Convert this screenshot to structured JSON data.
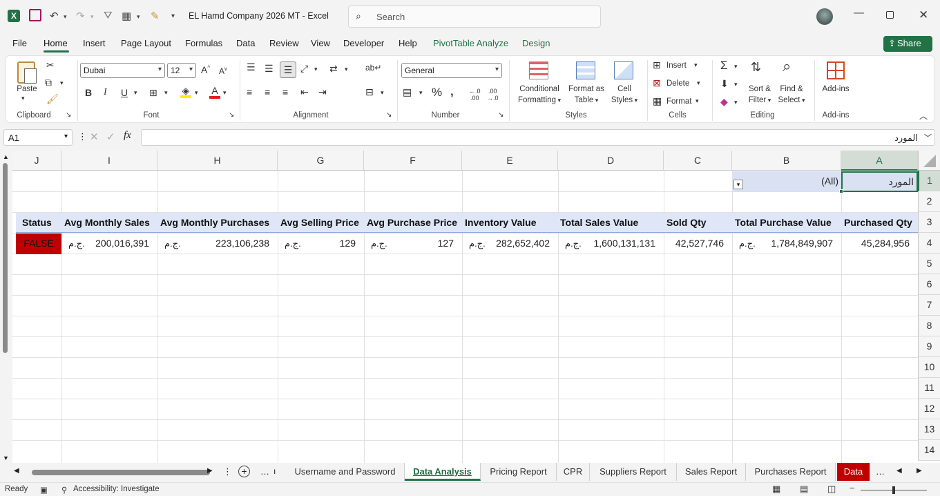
{
  "window": {
    "title": "EL Hamd Company 2026  MT  -  Excel",
    "search_placeholder": "Search"
  },
  "menu": [
    "File",
    "Home",
    "Insert",
    "Page Layout",
    "Formulas",
    "Data",
    "Review",
    "View",
    "Developer",
    "Help",
    "PivotTable Analyze",
    "Design"
  ],
  "share_label": "Share",
  "ribbon": {
    "clipboard": {
      "paste": "Paste",
      "group": "Clipboard"
    },
    "font": {
      "name": "Dubai",
      "size": "12",
      "group": "Font"
    },
    "alignment": {
      "group": "Alignment"
    },
    "number": {
      "format": "General",
      "group": "Number"
    },
    "styles": {
      "conditional": "Conditional",
      "formatting": "Formatting",
      "format_as": "Format as",
      "table": "Table",
      "cell": "Cell",
      "cell_styles": "Styles",
      "group": "Styles"
    },
    "cells": {
      "insert": "Insert",
      "delete": "Delete",
      "format": "Format",
      "group": "Cells"
    },
    "editing": {
      "sort": "Sort &",
      "filter": "Filter",
      "find": "Find &",
      "select": "Select",
      "group": "Editing"
    },
    "addins": {
      "label": "Add-ins",
      "group": "Add-ins"
    }
  },
  "formula_bar": {
    "name_box": "A1",
    "content": "المورد"
  },
  "columns": [
    "J",
    "I",
    "H",
    "G",
    "F",
    "E",
    "D",
    "C",
    "B",
    "A"
  ],
  "rows": [
    "1",
    "2",
    "3",
    "4",
    "5",
    "6",
    "7",
    "8",
    "9",
    "10",
    "11",
    "12",
    "13",
    "14"
  ],
  "cells": {
    "a1": "المورد",
    "b1": "(All)",
    "headers": {
      "j": "Status",
      "i": "Avg Monthly Sales",
      "h": "Avg Monthly Purchases",
      "g": "Avg Selling Price",
      "f": "Avg Purchase Price",
      "e": "Inventory Value",
      "d": "Total Sales Value",
      "c": "Sold Qty",
      "b": "Total Purchase Value",
      "a": "Purchased Qty"
    },
    "values": {
      "j": "FALSE",
      "i": "200,016,391",
      "h": "223,106,238",
      "g": "129",
      "f": "127",
      "e": "282,652,402",
      "d": "1,600,131,131",
      "c": "42,527,746",
      "b": "1,784,849,907",
      "a": "45,284,956"
    },
    "currency": "ج.م."
  },
  "sheet_tabs": [
    "Username and Password",
    "Data Analysis",
    "Pricing Report",
    "CPR",
    "Suppliers Report",
    "Sales Report",
    "Purchases Report",
    "Data"
  ],
  "status": {
    "ready": "Ready",
    "accessibility": "Accessibility: Investigate"
  },
  "colors": {
    "accent": "#217346",
    "status_false_bg": "#c00000",
    "header_fill": "#dfe6f7",
    "filter_fill": "#d9e1f2",
    "data_tab": "#c00000"
  }
}
